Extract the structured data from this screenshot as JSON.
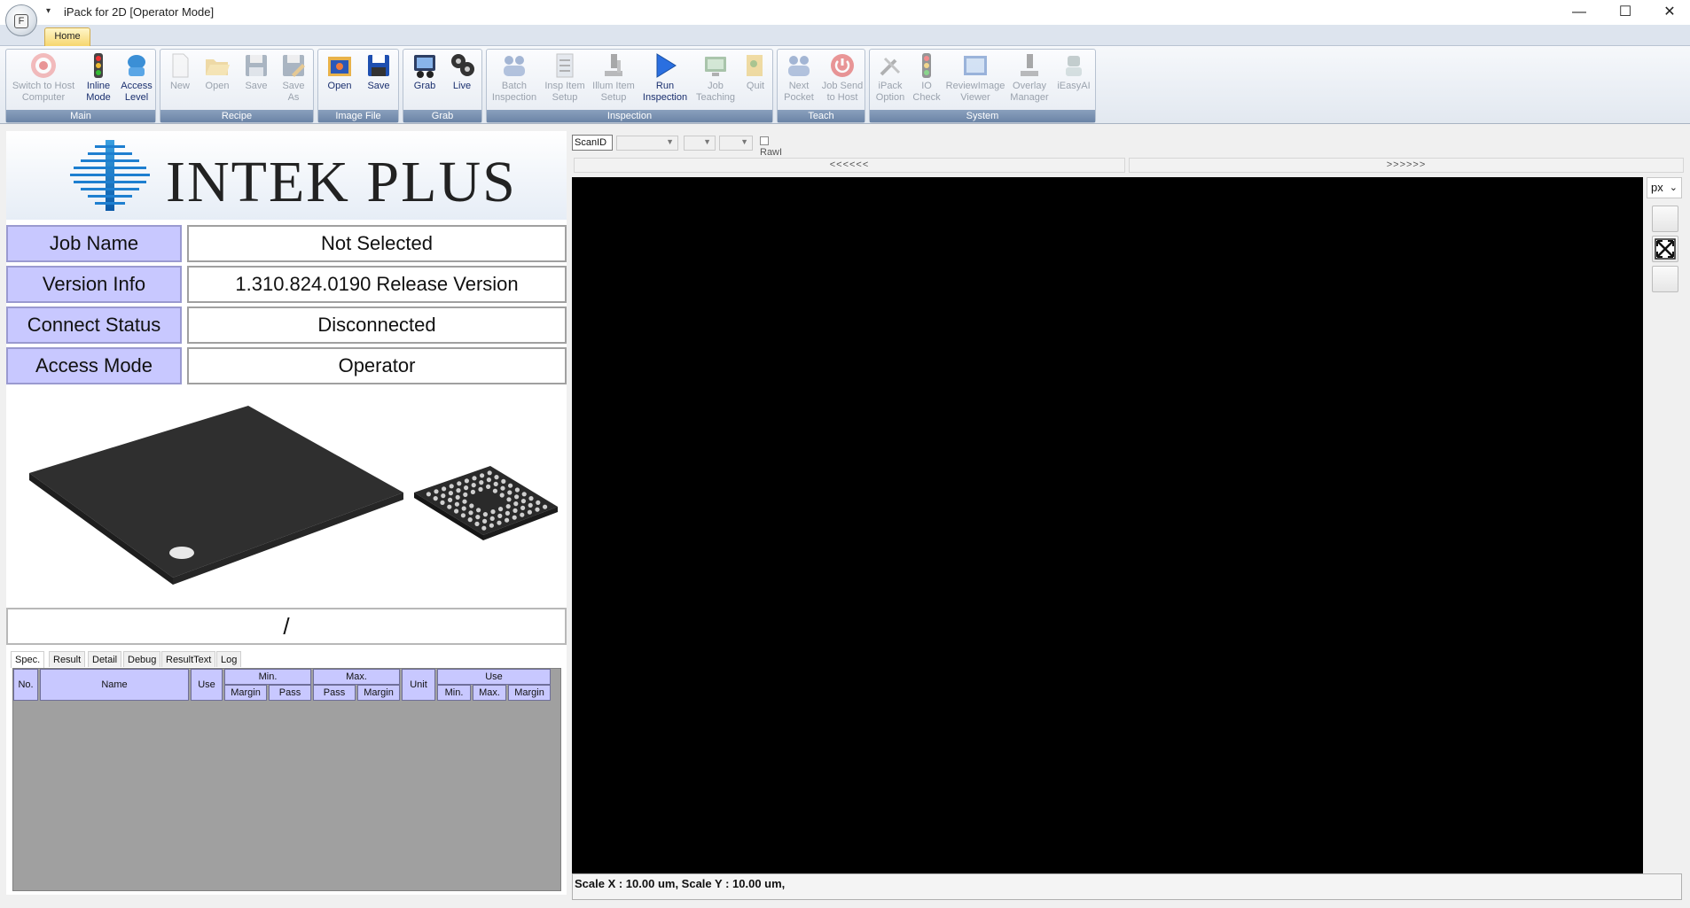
{
  "window": {
    "title": "iPack for 2D [Operator Mode]",
    "orb_label": "F",
    "minimize": "—",
    "maximize": "☐",
    "close": "✕"
  },
  "ribbon": {
    "tab_home": "Home",
    "groups": {
      "main": "Main",
      "recipe": "Recipe",
      "image_file": "Image File",
      "grab": "Grab",
      "inspection": "Inspection",
      "teach": "Teach",
      "system": "System"
    },
    "buttons": {
      "switch_host_1": "Switch to Host",
      "switch_host_2": "Computer",
      "inline_1": "Inline",
      "inline_2": "Mode",
      "access_1": "Access",
      "access_2": "Level",
      "new": "New",
      "open_recipe": "Open",
      "save_recipe": "Save",
      "save_as_1": "Save",
      "save_as_2": "As",
      "open_image": "Open",
      "save_image": "Save",
      "grab": "Grab",
      "live": "Live",
      "batch_1": "Batch",
      "batch_2": "Inspection",
      "insp_item_1": "Insp Item",
      "insp_item_2": "Setup",
      "illum_1": "Illum Item",
      "illum_2": "Setup",
      "run_1": "Run",
      "run_2": "Inspection",
      "job_teach_1": "Job",
      "job_teach_2": "Teaching",
      "quit": "Quit",
      "next_pocket_1": "Next",
      "next_pocket_2": "Pocket",
      "job_send_1": "Job Send",
      "job_send_2": "to Host",
      "ipack_opt_1": "iPack",
      "ipack_opt_2": "Option",
      "io_1": "IO",
      "io_2": "Check",
      "review_1": "ReviewImage",
      "review_2": "Viewer",
      "overlay_1": "Overlay",
      "overlay_2": "Manager",
      "ieasyai": "iEasyAI"
    }
  },
  "brand": {
    "logo_text": "INTEK PLUS"
  },
  "info": {
    "job_name_label": "Job Name",
    "job_name_value": "Not Selected",
    "version_label": "Version Info",
    "version_value": "1.310.824.0190 Release Version",
    "connect_label": "Connect Status",
    "connect_value": "Disconnected",
    "access_label": "Access Mode",
    "access_value": "Operator"
  },
  "slash_text": "/",
  "result_tabs": [
    "Spec.",
    "Result",
    "Detail",
    "Debug",
    "ResultText",
    "Log"
  ],
  "spec_headers": {
    "no": "No.",
    "name": "Name",
    "use": "Use",
    "min": "Min.",
    "max": "Max.",
    "unit": "Unit",
    "use_group": "Use",
    "margin": "Margin",
    "pass": "Pass",
    "use_min": "Min.",
    "use_max": "Max.",
    "use_margin": "Margin"
  },
  "viewer": {
    "scan_id": "ScanID",
    "rawi": "RawI",
    "prev": "<<<<<<",
    "next": ">>>>>>",
    "unit": "px",
    "status": "Scale X : 10.00 um, Scale Y : 10.00 um,"
  },
  "colors": {
    "label_bg": "#c8c8ff",
    "viewer_bg": "#000000",
    "group_label": "#6b84a6",
    "home_tab": "#f6d66f"
  }
}
